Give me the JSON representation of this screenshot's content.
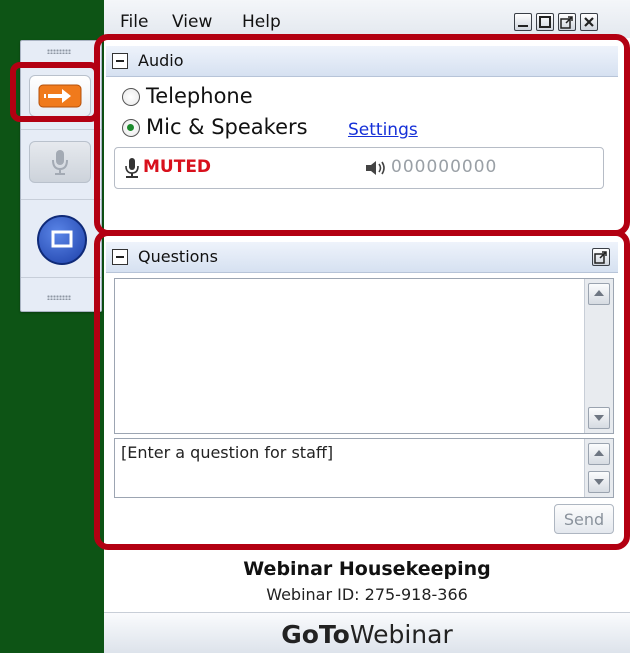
{
  "menu": {
    "file": "File",
    "view": "View",
    "help": "Help"
  },
  "audio": {
    "title": "Audio",
    "option_telephone": "Telephone",
    "option_mic": "Mic & Speakers",
    "selected": "Mic & Speakers",
    "settings_link": "Settings",
    "mute_status": "MUTED",
    "level_meter": "000000000"
  },
  "questions": {
    "title": "Questions",
    "input_placeholder": "[Enter a question for staff]",
    "send_label": "Send"
  },
  "footer": {
    "title": "Webinar Housekeeping",
    "webinar_id": "Webinar ID: 275-918-366",
    "brand_bold": "GoTo",
    "brand_regular": "Webinar"
  },
  "colors": {
    "background": "#0d5415",
    "highlight_frame": "#b30012",
    "share_button": "#f07a1c",
    "muted_text": "#d8101c",
    "link": "#1530d8"
  },
  "icons": [
    "arrow-right-icon",
    "microphone-icon",
    "screen-icon",
    "minimize-icon",
    "restore-icon",
    "popout-icon",
    "close-icon",
    "speaker-icon"
  ]
}
